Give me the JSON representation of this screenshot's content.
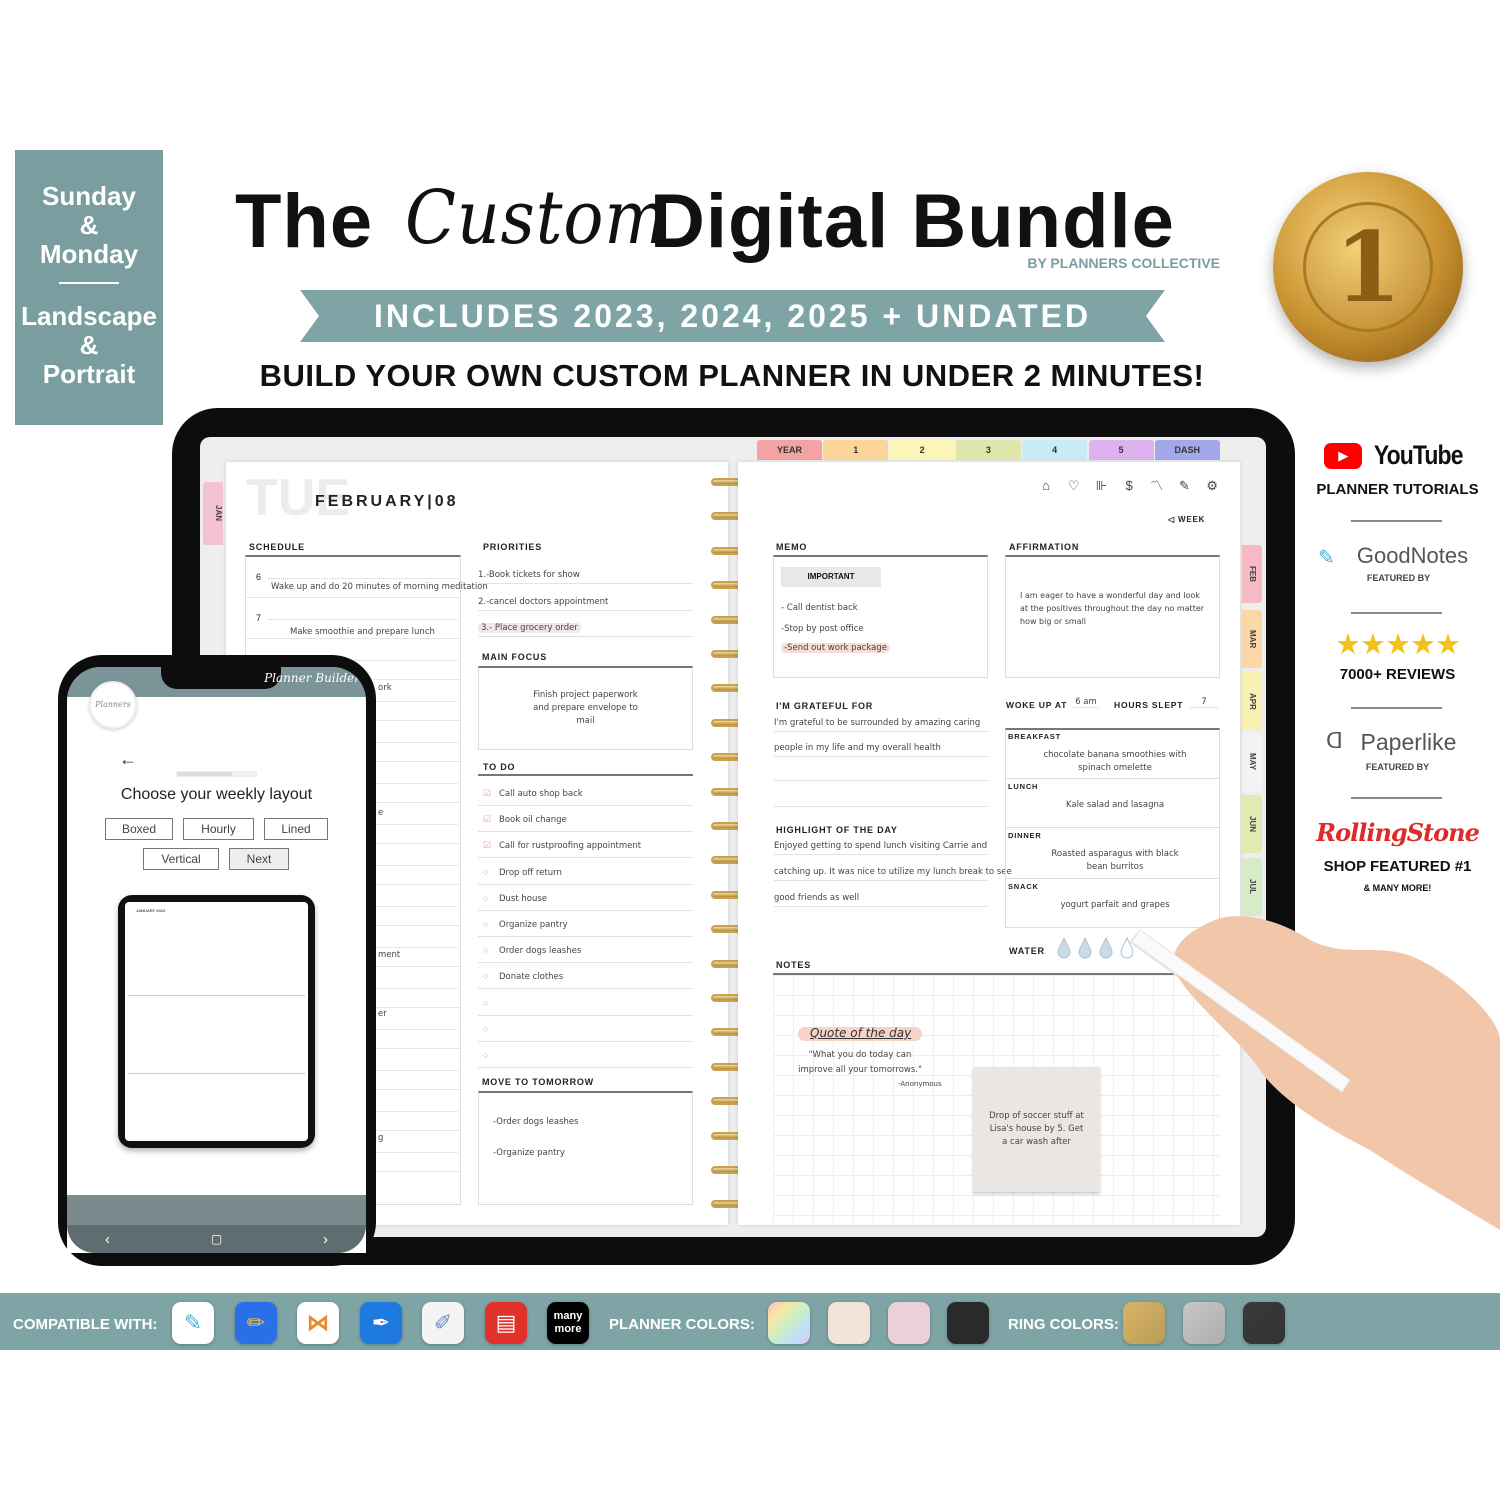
{
  "badge": {
    "line1": "Sunday",
    "amp1": "&",
    "line2": "Monday",
    "line3": "Landscape",
    "amp2": "&",
    "line4": "Portrait"
  },
  "header": {
    "title_the": "The",
    "title_custom": "Custom",
    "title_rest": "Digital Bundle",
    "byline": "BY PLANNERS COLLECTIVE",
    "ribbon": "INCLUDES 2023, 2024, 2025 + UNDATED",
    "subheading": "BUILD YOUR OWN CUSTOM PLANNER IN UNDER 2 MINUTES!",
    "medal": "1"
  },
  "planner": {
    "day": "TUE",
    "date": "FEBRUARY|08",
    "top_tabs": [
      {
        "label": "YEAR",
        "color": "#f3a3a3"
      },
      {
        "label": "1",
        "color": "#fbd59a"
      },
      {
        "label": "2",
        "color": "#fbf5b8"
      },
      {
        "label": "3",
        "color": "#dfe6ab"
      },
      {
        "label": "4",
        "color": "#c8ecf3"
      },
      {
        "label": "5",
        "color": "#ddb3ef"
      },
      {
        "label": "DASH",
        "color": "#a3a8ea"
      }
    ],
    "left_tab": {
      "label": "JAN",
      "color": "#f3c3d3"
    },
    "side_tabs": [
      {
        "label": "FEB",
        "color": "#f7b9c3"
      },
      {
        "label": "MAR",
        "color": "#fbd6a6"
      },
      {
        "label": "APR",
        "color": "#fbf0b4"
      },
      {
        "label": "MAY",
        "color": "#f3f3f3"
      },
      {
        "label": "JUN",
        "color": "#e2ebb3"
      },
      {
        "label": "JUL",
        "color": "#d7ecc8"
      }
    ],
    "toolbar_icons": [
      "home-icon",
      "heart-icon",
      "dumbbell-icon",
      "dollar-icon",
      "chart-icon",
      "pencil-icon",
      "gear-icon"
    ],
    "week_link": "◁ WEEK",
    "schedule": {
      "title": "SCHEDULE",
      "rows": [
        {
          "hour": "6",
          "text": "Wake up and do 20 minutes of morning meditation"
        },
        {
          "hour": "7",
          "text": "Make smoothie and prepare lunch"
        }
      ],
      "fragments": [
        "ork",
        "e",
        "ment",
        "er",
        "g"
      ]
    },
    "priorities": {
      "title": "PRIORITIES",
      "items": [
        "1.-Book tickets for show",
        "2.-cancel doctors appointment",
        "3.- Place grocery order"
      ]
    },
    "main_focus": {
      "title": "MAIN FOCUS",
      "text": "Finish project paperwork and prepare envelope to mail"
    },
    "todo": {
      "title": "TO DO",
      "items": [
        {
          "text": "Call auto shop back",
          "done": true
        },
        {
          "text": "Book oil change",
          "done": true
        },
        {
          "text": "Call for rustproofing appointment",
          "done": true
        },
        {
          "text": "Drop off return",
          "done": false
        },
        {
          "text": "Dust house",
          "done": false
        },
        {
          "text": "Organize pantry",
          "done": false
        },
        {
          "text": "Order dogs leashes",
          "done": false
        },
        {
          "text": "Donate clothes",
          "done": false
        },
        {
          "text": "",
          "done": false
        },
        {
          "text": "",
          "done": false
        },
        {
          "text": "",
          "done": false
        }
      ]
    },
    "move_to_tomorrow": {
      "title": "MOVE TO TOMORROW",
      "items": [
        "-Order dogs leashes",
        "-Organize pantry"
      ]
    },
    "memo": {
      "title": "MEMO",
      "tag": "IMPORTANT",
      "items": [
        "- Call dentist back",
        "-Stop by post office",
        "-Send out work package"
      ]
    },
    "affirmation": {
      "title": "AFFIRMATION",
      "text": "I am eager to have a wonderful day and look at the positives throughout the day no matter how big or small"
    },
    "grateful": {
      "title": "I'M GRATEFUL FOR",
      "lines": [
        "I'm grateful to be surrounded by amazing caring",
        "people in my life and my overall health"
      ]
    },
    "highlight": {
      "title": "HIGHLIGHT OF THE DAY",
      "lines": [
        "Enjoyed getting to spend lunch visiting Carrie and",
        "catching up. It was nice to utilize my lunch break to see",
        "good friends as well"
      ]
    },
    "sleep": {
      "woke_label": "WOKE UP AT",
      "woke_value": "6 am",
      "hours_label": "HOURS SLEPT",
      "hours_value": "7"
    },
    "meals": [
      {
        "label": "BREAKFAST",
        "text": "chocolate banana smoothies with spinach omelette"
      },
      {
        "label": "LUNCH",
        "text": "Kale salad and lasagna"
      },
      {
        "label": "DINNER",
        "text": "Roasted asparagus with black bean burritos"
      },
      {
        "label": "SNACK",
        "text": "yogurt parfait and grapes"
      }
    ],
    "water": {
      "label": "WATER",
      "filled": 3,
      "total": 4
    },
    "notes": {
      "title": "NOTES",
      "quote_title": "Quote of the day",
      "quote": "\"What you do today can improve all your tomorrows.\"",
      "quote_author": "-Anonymous",
      "sticky": "Drop of soccer stuff at Lisa's house by 5. Get a car wash after"
    }
  },
  "phone": {
    "header_script": "Planner Builder",
    "logo_text": "Planners",
    "back": "←",
    "progress": 0.7,
    "heading": "Choose your weekly layout",
    "options": [
      "Boxed",
      "Hourly",
      "Lined",
      "Vertical",
      "Next"
    ],
    "preview_title": "JANUARY 2023"
  },
  "sidebar": {
    "youtube": "YouTube",
    "youtube_caption": "PLANNER TUTORIALS",
    "goodnotes": "GoodNotes",
    "goodnotes_caption": "FEATURED BY",
    "stars": "★★★★★",
    "rating": 5,
    "reviews": "7000+  REVIEWS",
    "paperlike": "Paperlike",
    "paperlike_caption": "FEATURED BY",
    "rollingstone": "RollingStone",
    "rollingstone_caption": "SHOP FEATURED #1",
    "more": "& MANY MORE!"
  },
  "footer": {
    "compatible_label": "COMPATIBLE WITH:",
    "apps": [
      "goodnotes-icon",
      "notability-icon",
      "xodo-icon",
      "pdf-expert-icon",
      "noteshelf-icon",
      "zoomnotes-icon",
      "many-more-icon"
    ],
    "many_more": "many more",
    "planner_colors_label": "PLANNER COLORS:",
    "planner_colors": [
      "rainbow",
      "#f2e4d6",
      "#ebd0d8",
      "#2a2a2a"
    ],
    "ring_colors_label": "RING COLORS:",
    "ring_colors": [
      "#d7b466",
      "#c8c8c8",
      "#3a3a3a"
    ]
  }
}
